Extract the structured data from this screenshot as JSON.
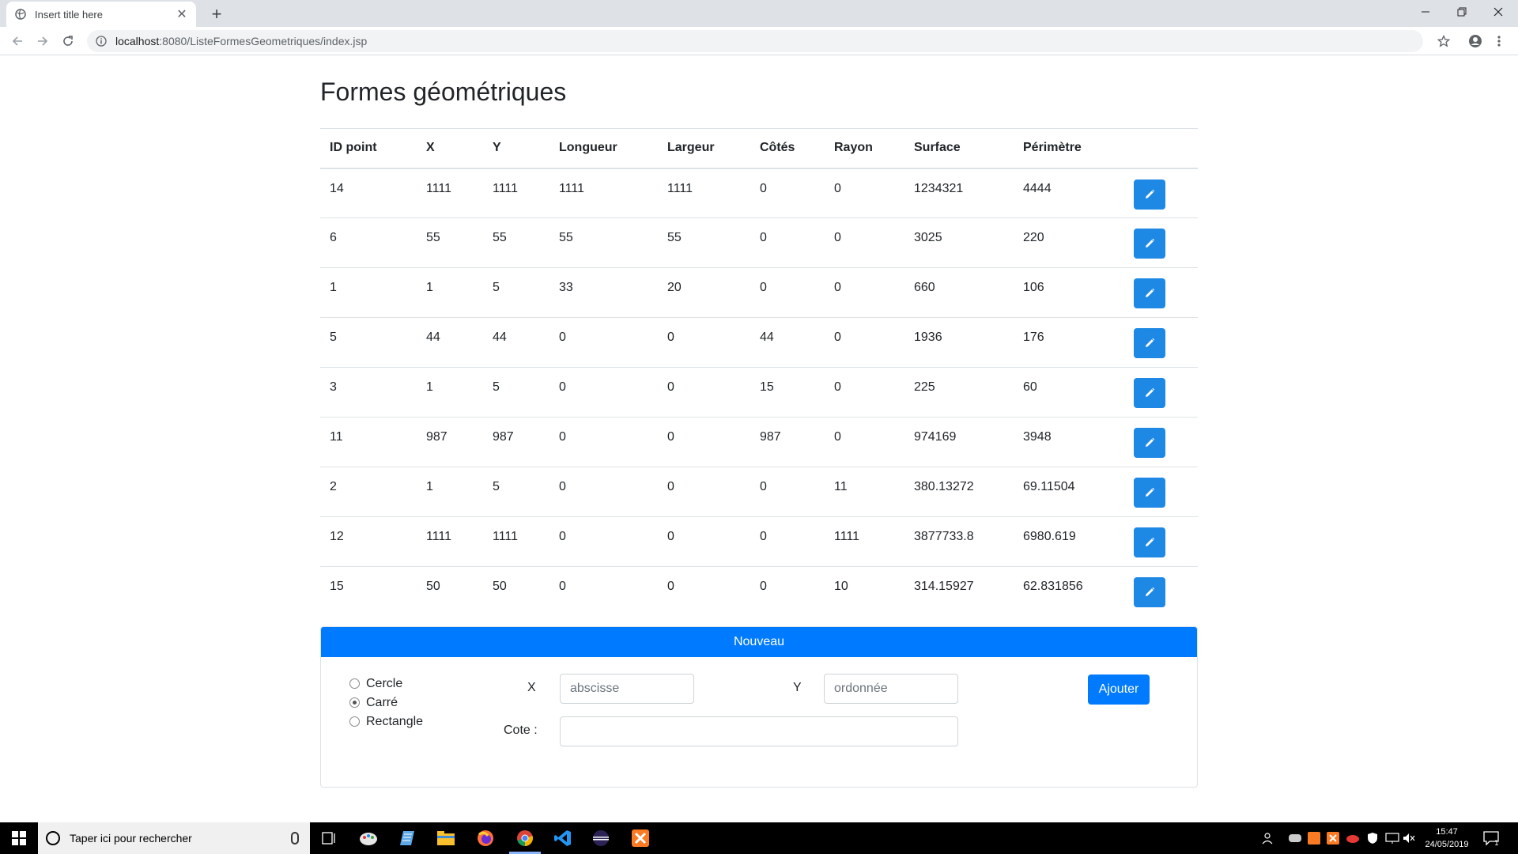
{
  "browser": {
    "tab_title": "Insert title here",
    "tab_close": "✕",
    "new_tab": "+",
    "url_host": "localhost",
    "url_path": ":8080/ListeFormesGeometriques/index.jsp"
  },
  "page": {
    "title": "Formes géométriques",
    "columns": [
      "ID point",
      "X",
      "Y",
      "Longueur",
      "Largeur",
      "Côtés",
      "Rayon",
      "Surface",
      "Périmètre"
    ],
    "rows": [
      [
        "14",
        "1111",
        "1111",
        "1111",
        "1111",
        "0",
        "0",
        "1234321",
        "4444"
      ],
      [
        "6",
        "55",
        "55",
        "55",
        "55",
        "0",
        "0",
        "3025",
        "220"
      ],
      [
        "1",
        "1",
        "5",
        "33",
        "20",
        "0",
        "0",
        "660",
        "106"
      ],
      [
        "5",
        "44",
        "44",
        "0",
        "0",
        "44",
        "0",
        "1936",
        "176"
      ],
      [
        "3",
        "1",
        "5",
        "0",
        "0",
        "15",
        "0",
        "225",
        "60"
      ],
      [
        "11",
        "987",
        "987",
        "0",
        "0",
        "987",
        "0",
        "974169",
        "3948"
      ],
      [
        "2",
        "1",
        "5",
        "0",
        "0",
        "0",
        "11",
        "380.13272",
        "69.11504"
      ],
      [
        "12",
        "1111",
        "1111",
        "0",
        "0",
        "0",
        "1111",
        "3877733.8",
        "6980.619"
      ],
      [
        "15",
        "50",
        "50",
        "0",
        "0",
        "0",
        "10",
        "314.15927",
        "62.831856"
      ]
    ]
  },
  "form": {
    "header": "Nouveau",
    "shapes": [
      {
        "label": "Cercle",
        "checked": false
      },
      {
        "label": "Carré",
        "checked": true
      },
      {
        "label": "Rectangle",
        "checked": false
      }
    ],
    "x_label": "X",
    "x_placeholder": "abscisse",
    "y_label": "Y",
    "y_placeholder": "ordonnée",
    "cote_label": "Cote :",
    "cote_value": "",
    "add_label": "Ajouter"
  },
  "taskbar": {
    "search_placeholder": "Taper ici pour rechercher",
    "time": "15:47",
    "date": "24/05/2019",
    "notification_count": "1"
  },
  "colors": {
    "primary": "#007bff",
    "edit_button": "#1e88e5"
  }
}
